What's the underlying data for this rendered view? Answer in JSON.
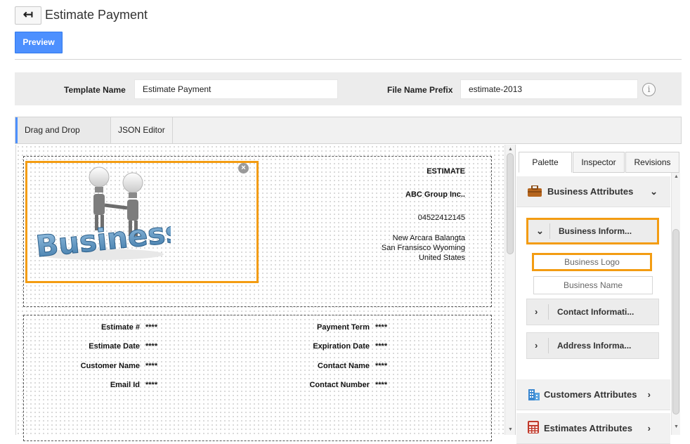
{
  "header": {
    "back_icon": "back-arrow-icon",
    "back_glyph": "↤",
    "title": "Estimate Payment",
    "preview_label": "Preview"
  },
  "settings": {
    "template_name_label": "Template Name",
    "template_name_value": "Estimate Payment",
    "file_prefix_label": "File Name Prefix",
    "file_prefix_value": "estimate-2013",
    "info_glyph": "i"
  },
  "editor_tabs": [
    {
      "label": "Drag and Drop Editor",
      "active": true
    },
    {
      "label": "JSON Editor",
      "active": false
    }
  ],
  "canvas": {
    "logo_image": "business-logo-image",
    "logo_word": "Business",
    "header_lines": {
      "doc_type": "ESTIMATE",
      "company": "ABC Group Inc..",
      "phone": "04522412145",
      "address1": "New Arcara Balangta",
      "address2": "San Fransisco  Wyoming",
      "address3": "United States"
    },
    "fields_left": [
      {
        "label": "Estimate #",
        "value": "****"
      },
      {
        "label": "Estimate Date",
        "value": "****"
      },
      {
        "label": "Customer Name",
        "value": "****"
      },
      {
        "label": "Email Id",
        "value": "****"
      }
    ],
    "fields_right": [
      {
        "label": "Payment Term",
        "value": "****"
      },
      {
        "label": "Expiration Date",
        "value": "****"
      },
      {
        "label": "Contact Name",
        "value": "****"
      },
      {
        "label": "Contact Number",
        "value": "****"
      }
    ]
  },
  "panel": {
    "tabs": [
      {
        "label": "Palette",
        "active": true
      },
      {
        "label": "Inspector",
        "active": false
      },
      {
        "label": "Revisions",
        "active": false
      }
    ],
    "business_attributes": "Business Attributes",
    "business_info": "Business Inform...",
    "business_logo": "Business Logo",
    "business_name": "Business Name",
    "contact_info": "Contact Informati...",
    "address_info": "Address Informa...",
    "customers_attributes": "Customers Attributes",
    "estimates_attributes": "Estimates Attributes"
  },
  "colors": {
    "accent_blue": "#4d90fe",
    "highlight_orange": "#f39c12"
  }
}
